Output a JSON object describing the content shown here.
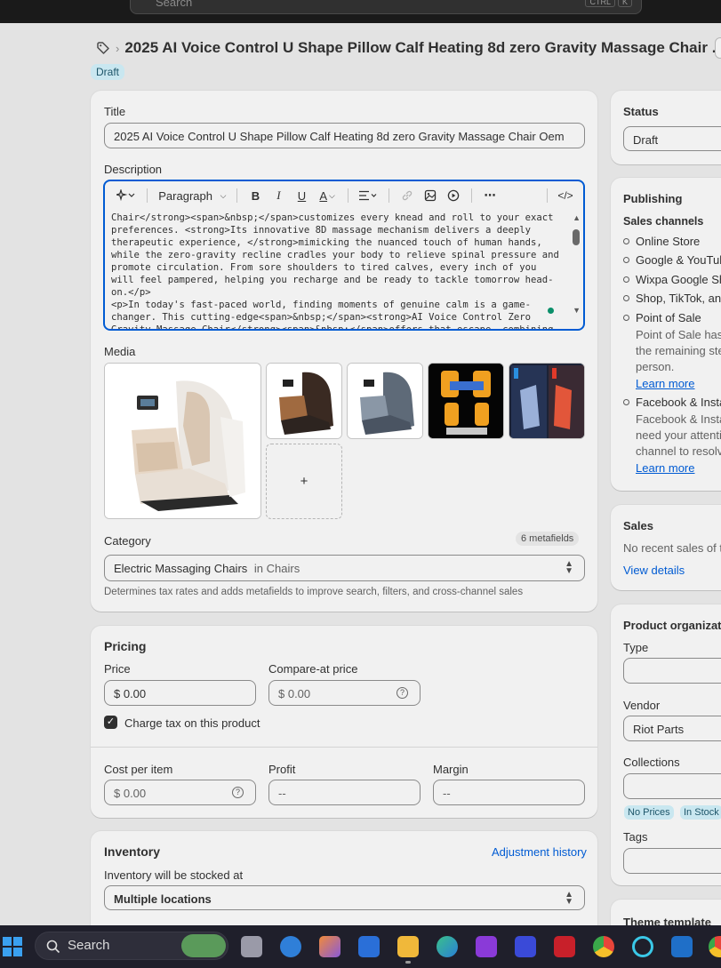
{
  "topbar": {
    "search_placeholder": "Search",
    "shortcut_keys": [
      "CTRL",
      "K"
    ]
  },
  "header": {
    "title": "2025 AI Voice Control U Shape Pillow Calf Heating 8d zero Gravity Massage Chair ...",
    "status_badge": "Draft"
  },
  "product": {
    "title_label": "Title",
    "title_value": "2025 AI Voice Control U Shape Pillow Calf Heating 8d zero Gravity Massage Chair Oem",
    "description_label": "Description",
    "editor_toolbar": {
      "format_select": "Paragraph",
      "bold": "B",
      "italic": "I",
      "underline": "U",
      "text_color": "A",
      "more": "⋯",
      "code": "</>"
    },
    "description_html": "Chair</strong><span>&nbsp;</span>customizes every knead and roll to your exact\npreferences. <strong>Its innovative 8D massage mechanism delivers a deeply\ntherapeutic experience, </strong>mimicking the nuanced touch of human hands,\nwhile the zero-gravity recline cradles your body to relieve spinal pressure and\npromote circulation. From sore shoulders to tired calves, every inch of you\nwill feel pampered, helping you recharge and be ready to tackle tomorrow head-\non.</p>\n<p>In today's fast-paced world, finding moments of genuine calm is a game-\nchanger. This cutting-edge<span>&nbsp;</span><strong>AI Voice Control Zero\nGravity Massage Chair</strong><span>&nbsp;</span>offers that escape, combining",
    "media_label": "Media",
    "add_media": "+",
    "category_label": "Category",
    "metafields_badge": "6 metafields",
    "category_value": "Electric Massaging Chairs",
    "category_parent": "in Chairs",
    "category_help": "Determines tax rates and adds metafields to improve search, filters, and cross-channel sales"
  },
  "pricing": {
    "heading": "Pricing",
    "price_label": "Price",
    "price_value": "$ 0.00",
    "compare_label": "Compare-at price",
    "compare_value": "$ 0.00",
    "charge_tax_label": "Charge tax on this product",
    "charge_tax_checked": true,
    "cost_label": "Cost per item",
    "cost_value": "$ 0.00",
    "profit_label": "Profit",
    "profit_value": "--",
    "margin_label": "Margin",
    "margin_value": "--",
    "help_glyph": "?"
  },
  "inventory": {
    "heading": "Inventory",
    "history_link": "Adjustment history",
    "stocked_label": "Inventory will be stocked at",
    "location_value": "Multiple locations"
  },
  "status": {
    "heading": "Status",
    "value": "Draft"
  },
  "publishing": {
    "heading": "Publishing",
    "sales_channels_label": "Sales channels",
    "channels": [
      "Online Store",
      "Google & YouTub",
      "Wixpa Google Sh",
      "Shop, TikTok, and"
    ],
    "pos": {
      "name": "Point of Sale",
      "lines": [
        "Point of Sale has",
        "the remaining ste",
        "person."
      ],
      "link": "Learn more"
    },
    "facebook": {
      "name": "Facebook & Insta",
      "lines": [
        "Facebook & Insta",
        "need your attenti",
        "channel to resolv"
      ],
      "link": "Learn more"
    }
  },
  "sales": {
    "heading": "Sales",
    "text": "No recent sales of t",
    "link": "View details"
  },
  "organization": {
    "heading": "Product organizatio",
    "type_label": "Type",
    "vendor_label": "Vendor",
    "vendor_value": "Riot Parts",
    "collections_label": "Collections",
    "collection_chips": [
      "No Prices",
      "In Stock"
    ],
    "tags_label": "Tags"
  },
  "theme": {
    "heading": "Theme template"
  },
  "taskbar": {
    "search_label": "Search"
  },
  "colors": {
    "accent": "#005bd3",
    "badge_bg": "#c9e7f0",
    "page_bg": "#e3e3e3",
    "card_bg": "#f1f1f1"
  }
}
